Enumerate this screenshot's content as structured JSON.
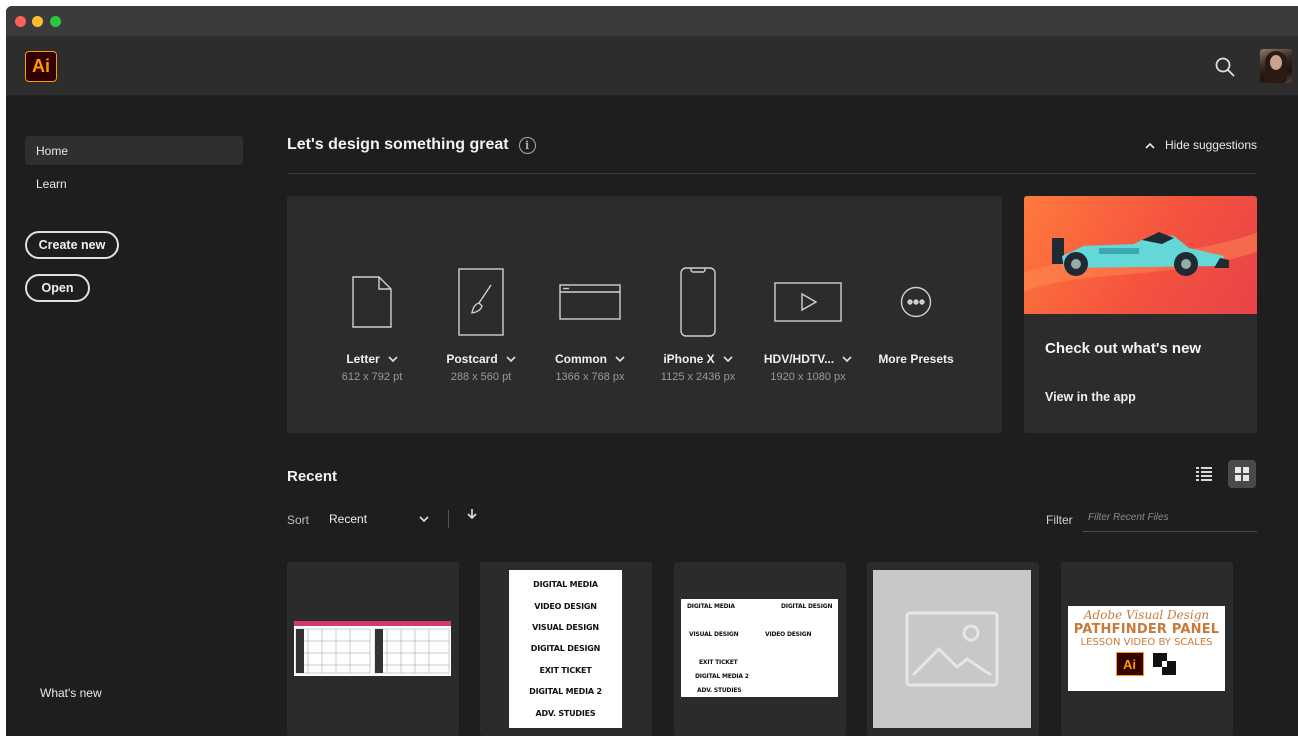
{
  "app": {
    "logo_text": "Ai"
  },
  "sidebar": {
    "items": [
      {
        "label": "Home"
      },
      {
        "label": "Learn"
      }
    ],
    "create_new": "Create new",
    "open": "Open",
    "whats_new": "What's new"
  },
  "main": {
    "headline": "Let's design something great",
    "hide_suggestions": "Hide suggestions",
    "presets": [
      {
        "name": "Letter",
        "size": "612 x 792 pt"
      },
      {
        "name": "Postcard",
        "size": "288 x 560 pt"
      },
      {
        "name": "Common",
        "size": "1366 x 768 px"
      },
      {
        "name": "iPhone X",
        "size": "1125 x 2436 px"
      },
      {
        "name": "HDV/HDTV...",
        "size": "1920 x 1080 px"
      },
      {
        "name": "More Presets",
        "size": ""
      }
    ],
    "whats_new_card": {
      "title": "Check out what's new",
      "link": "View in the app"
    },
    "recent": {
      "title": "Recent",
      "sort_label": "Sort",
      "sort_value": "Recent",
      "filter_label": "Filter",
      "filter_placeholder": "Filter Recent Files"
    },
    "thumbnails": {
      "dm_lines": [
        "DIGITAL MEDIA",
        "VIDEO DESIGN",
        "VISUAL DESIGN",
        "DIGITAL DESIGN",
        "EXIT TICKET",
        "DIGITAL MEDIA 2",
        "ADV. STUDIES"
      ],
      "t3_lines": [
        "DIGITAL MEDIA",
        "DIGITAL DESIGN",
        "VISUAL DESIGN",
        "VIDEO DESIGN",
        "EXIT TICKET",
        "DIGITAL MEDIA 2",
        "ADV. STUDIES"
      ],
      "t5_script": "Adobe Visual Design",
      "t5_title": "PATHFINDER PANEL",
      "t5_sub": "LESSON VIDEO BY SCALES",
      "t5_logo": "Ai"
    }
  },
  "colors": {
    "accent_ai": "#ff9a00",
    "background": "#1e1e1e",
    "card": "#2c2c2c"
  }
}
